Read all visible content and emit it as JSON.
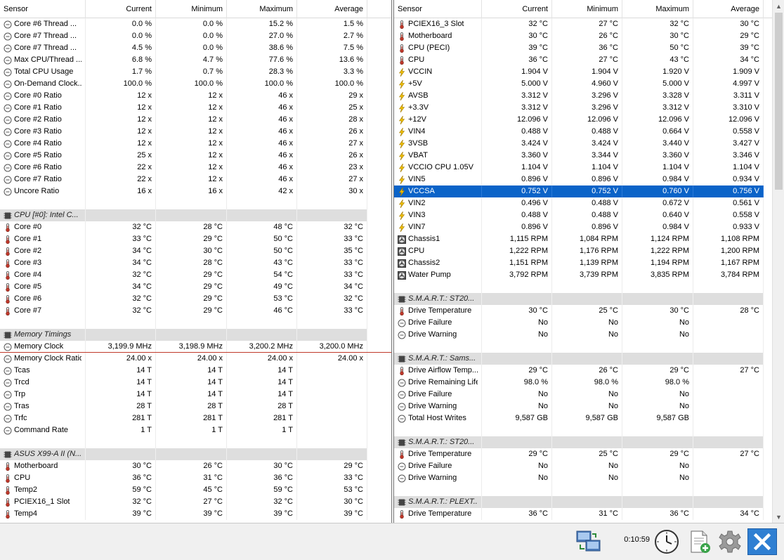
{
  "columns": {
    "sensor": "Sensor",
    "current": "Current",
    "minimum": "Minimum",
    "maximum": "Maximum",
    "average": "Average"
  },
  "left_rows": [
    {
      "type": "row",
      "icon": "clock",
      "name": "Core #6 Thread ...",
      "cur": "0.0 %",
      "min": "0.0 %",
      "max": "15.2 %",
      "avg": "1.5 %"
    },
    {
      "type": "row",
      "icon": "clock",
      "name": "Core #7 Thread ...",
      "cur": "0.0 %",
      "min": "0.0 %",
      "max": "27.0 %",
      "avg": "2.7 %"
    },
    {
      "type": "row",
      "icon": "clock",
      "name": "Core #7 Thread ...",
      "cur": "4.5 %",
      "min": "0.0 %",
      "max": "38.6 %",
      "avg": "7.5 %"
    },
    {
      "type": "row",
      "icon": "clock",
      "name": "Max CPU/Thread ...",
      "cur": "6.8 %",
      "min": "4.7 %",
      "max": "77.6 %",
      "avg": "13.6 %"
    },
    {
      "type": "row",
      "icon": "clock",
      "name": "Total CPU Usage",
      "cur": "1.7 %",
      "min": "0.7 %",
      "max": "28.3 %",
      "avg": "3.3 %"
    },
    {
      "type": "row",
      "icon": "clock",
      "name": "On-Demand Clock...",
      "cur": "100.0 %",
      "min": "100.0 %",
      "max": "100.0 %",
      "avg": "100.0 %"
    },
    {
      "type": "row",
      "icon": "clock",
      "name": "Core #0 Ratio",
      "cur": "12 x",
      "min": "12 x",
      "max": "46 x",
      "avg": "29 x"
    },
    {
      "type": "row",
      "icon": "clock",
      "name": "Core #1 Ratio",
      "cur": "12 x",
      "min": "12 x",
      "max": "46 x",
      "avg": "25 x"
    },
    {
      "type": "row",
      "icon": "clock",
      "name": "Core #2 Ratio",
      "cur": "12 x",
      "min": "12 x",
      "max": "46 x",
      "avg": "28 x"
    },
    {
      "type": "row",
      "icon": "clock",
      "name": "Core #3 Ratio",
      "cur": "12 x",
      "min": "12 x",
      "max": "46 x",
      "avg": "26 x"
    },
    {
      "type": "row",
      "icon": "clock",
      "name": "Core #4 Ratio",
      "cur": "12 x",
      "min": "12 x",
      "max": "46 x",
      "avg": "27 x"
    },
    {
      "type": "row",
      "icon": "clock",
      "name": "Core #5 Ratio",
      "cur": "25 x",
      "min": "12 x",
      "max": "46 x",
      "avg": "26 x"
    },
    {
      "type": "row",
      "icon": "clock",
      "name": "Core #6 Ratio",
      "cur": "22 x",
      "min": "12 x",
      "max": "46 x",
      "avg": "23 x"
    },
    {
      "type": "row",
      "icon": "clock",
      "name": "Core #7 Ratio",
      "cur": "22 x",
      "min": "12 x",
      "max": "46 x",
      "avg": "27 x"
    },
    {
      "type": "row",
      "icon": "clock",
      "name": "Uncore Ratio",
      "cur": "16 x",
      "min": "16 x",
      "max": "42 x",
      "avg": "30 x"
    },
    {
      "type": "blank"
    },
    {
      "type": "group",
      "icon": "chip",
      "name": "CPU [#0]: Intel C..."
    },
    {
      "type": "row",
      "icon": "thermo",
      "name": "Core #0",
      "cur": "32 °C",
      "min": "28 °C",
      "max": "48 °C",
      "avg": "32 °C"
    },
    {
      "type": "row",
      "icon": "thermo",
      "name": "Core #1",
      "cur": "33 °C",
      "min": "29 °C",
      "max": "50 °C",
      "avg": "33 °C"
    },
    {
      "type": "row",
      "icon": "thermo",
      "name": "Core #2",
      "cur": "34 °C",
      "min": "30 °C",
      "max": "50 °C",
      "avg": "35 °C"
    },
    {
      "type": "row",
      "icon": "thermo",
      "name": "Core #3",
      "cur": "34 °C",
      "min": "28 °C",
      "max": "43 °C",
      "avg": "33 °C"
    },
    {
      "type": "row",
      "icon": "thermo",
      "name": "Core #4",
      "cur": "32 °C",
      "min": "29 °C",
      "max": "54 °C",
      "avg": "33 °C"
    },
    {
      "type": "row",
      "icon": "thermo",
      "name": "Core #5",
      "cur": "34 °C",
      "min": "29 °C",
      "max": "49 °C",
      "avg": "34 °C"
    },
    {
      "type": "row",
      "icon": "thermo",
      "name": "Core #6",
      "cur": "32 °C",
      "min": "29 °C",
      "max": "53 °C",
      "avg": "32 °C"
    },
    {
      "type": "row",
      "icon": "thermo",
      "name": "Core #7",
      "cur": "32 °C",
      "min": "29 °C",
      "max": "46 °C",
      "avg": "33 °C"
    },
    {
      "type": "blank"
    },
    {
      "type": "group",
      "icon": "chip",
      "name": "Memory Timings"
    },
    {
      "type": "row",
      "icon": "clock",
      "name": "Memory Clock",
      "cur": "3,199.9 MHz",
      "min": "3,198.9 MHz",
      "max": "3,200.2 MHz",
      "avg": "3,200.0 MHz",
      "redline": true
    },
    {
      "type": "row",
      "icon": "clock",
      "name": "Memory Clock Ratio",
      "cur": "24.00 x",
      "min": "24.00 x",
      "max": "24.00 x",
      "avg": "24.00 x"
    },
    {
      "type": "row",
      "icon": "clock",
      "name": "Tcas",
      "cur": "14 T",
      "min": "14 T",
      "max": "14 T",
      "avg": ""
    },
    {
      "type": "row",
      "icon": "clock",
      "name": "Trcd",
      "cur": "14 T",
      "min": "14 T",
      "max": "14 T",
      "avg": ""
    },
    {
      "type": "row",
      "icon": "clock",
      "name": "Trp",
      "cur": "14 T",
      "min": "14 T",
      "max": "14 T",
      "avg": ""
    },
    {
      "type": "row",
      "icon": "clock",
      "name": "Tras",
      "cur": "28 T",
      "min": "28 T",
      "max": "28 T",
      "avg": ""
    },
    {
      "type": "row",
      "icon": "clock",
      "name": "Trfc",
      "cur": "281 T",
      "min": "281 T",
      "max": "281 T",
      "avg": ""
    },
    {
      "type": "row",
      "icon": "clock",
      "name": "Command Rate",
      "cur": "1 T",
      "min": "1 T",
      "max": "1 T",
      "avg": ""
    },
    {
      "type": "blank"
    },
    {
      "type": "group",
      "icon": "chip",
      "name": "ASUS X99-A II (N..."
    },
    {
      "type": "row",
      "icon": "thermo",
      "name": "Motherboard",
      "cur": "30 °C",
      "min": "26 °C",
      "max": "30 °C",
      "avg": "29 °C"
    },
    {
      "type": "row",
      "icon": "thermo",
      "name": "CPU",
      "cur": "36 °C",
      "min": "31 °C",
      "max": "36 °C",
      "avg": "33 °C"
    },
    {
      "type": "row",
      "icon": "thermo",
      "name": "Temp2",
      "cur": "59 °C",
      "min": "45 °C",
      "max": "59 °C",
      "avg": "53 °C"
    },
    {
      "type": "row",
      "icon": "thermo",
      "name": "PCIEX16_1 Slot",
      "cur": "32 °C",
      "min": "27 °C",
      "max": "32 °C",
      "avg": "30 °C"
    },
    {
      "type": "row",
      "icon": "thermo",
      "name": "Temp4",
      "cur": "39 °C",
      "min": "39 °C",
      "max": "39 °C",
      "avg": "39 °C"
    }
  ],
  "right_rows": [
    {
      "type": "row",
      "icon": "thermo",
      "name": "PCIEX16_3 Slot",
      "cur": "32 °C",
      "min": "27 °C",
      "max": "32 °C",
      "avg": "30 °C"
    },
    {
      "type": "row",
      "icon": "thermo",
      "name": "Motherboard",
      "cur": "30 °C",
      "min": "26 °C",
      "max": "30 °C",
      "avg": "29 °C"
    },
    {
      "type": "row",
      "icon": "thermo",
      "name": "CPU (PECI)",
      "cur": "39 °C",
      "min": "36 °C",
      "max": "50 °C",
      "avg": "39 °C"
    },
    {
      "type": "row",
      "icon": "thermo",
      "name": "CPU",
      "cur": "36 °C",
      "min": "27 °C",
      "max": "43 °C",
      "avg": "34 °C"
    },
    {
      "type": "row",
      "icon": "bolt",
      "name": "VCCIN",
      "cur": "1.904 V",
      "min": "1.904 V",
      "max": "1.920 V",
      "avg": "1.909 V"
    },
    {
      "type": "row",
      "icon": "bolt",
      "name": "+5V",
      "cur": "5.000 V",
      "min": "4.960 V",
      "max": "5.000 V",
      "avg": "4.997 V"
    },
    {
      "type": "row",
      "icon": "bolt",
      "name": "AVSB",
      "cur": "3.312 V",
      "min": "3.296 V",
      "max": "3.328 V",
      "avg": "3.311 V"
    },
    {
      "type": "row",
      "icon": "bolt",
      "name": "+3.3V",
      "cur": "3.312 V",
      "min": "3.296 V",
      "max": "3.312 V",
      "avg": "3.310 V"
    },
    {
      "type": "row",
      "icon": "bolt",
      "name": "+12V",
      "cur": "12.096 V",
      "min": "12.096 V",
      "max": "12.096 V",
      "avg": "12.096 V"
    },
    {
      "type": "row",
      "icon": "bolt",
      "name": "VIN4",
      "cur": "0.488 V",
      "min": "0.488 V",
      "max": "0.664 V",
      "avg": "0.558 V"
    },
    {
      "type": "row",
      "icon": "bolt",
      "name": "3VSB",
      "cur": "3.424 V",
      "min": "3.424 V",
      "max": "3.440 V",
      "avg": "3.427 V"
    },
    {
      "type": "row",
      "icon": "bolt",
      "name": "VBAT",
      "cur": "3.360 V",
      "min": "3.344 V",
      "max": "3.360 V",
      "avg": "3.346 V"
    },
    {
      "type": "row",
      "icon": "bolt",
      "name": "VCCIO CPU 1.05V",
      "cur": "1.104 V",
      "min": "1.104 V",
      "max": "1.104 V",
      "avg": "1.104 V"
    },
    {
      "type": "row",
      "icon": "bolt",
      "name": "VIN5",
      "cur": "0.896 V",
      "min": "0.896 V",
      "max": "0.984 V",
      "avg": "0.934 V"
    },
    {
      "type": "row",
      "icon": "bolt",
      "name": "VCCSA",
      "cur": "0.752 V",
      "min": "0.752 V",
      "max": "0.760 V",
      "avg": "0.756 V",
      "selected": true
    },
    {
      "type": "row",
      "icon": "bolt",
      "name": "VIN2",
      "cur": "0.496 V",
      "min": "0.488 V",
      "max": "0.672 V",
      "avg": "0.561 V"
    },
    {
      "type": "row",
      "icon": "bolt",
      "name": "VIN3",
      "cur": "0.488 V",
      "min": "0.488 V",
      "max": "0.640 V",
      "avg": "0.558 V"
    },
    {
      "type": "row",
      "icon": "bolt",
      "name": "VIN7",
      "cur": "0.896 V",
      "min": "0.896 V",
      "max": "0.984 V",
      "avg": "0.933 V"
    },
    {
      "type": "row",
      "icon": "fan",
      "name": "Chassis1",
      "cur": "1,115 RPM",
      "min": "1,084 RPM",
      "max": "1,124 RPM",
      "avg": "1,108 RPM"
    },
    {
      "type": "row",
      "icon": "fan",
      "name": "CPU",
      "cur": "1,222 RPM",
      "min": "1,176 RPM",
      "max": "1,222 RPM",
      "avg": "1,200 RPM"
    },
    {
      "type": "row",
      "icon": "fan",
      "name": "Chassis2",
      "cur": "1,151 RPM",
      "min": "1,139 RPM",
      "max": "1,194 RPM",
      "avg": "1,167 RPM"
    },
    {
      "type": "row",
      "icon": "fan",
      "name": "Water Pump",
      "cur": "3,792 RPM",
      "min": "3,739 RPM",
      "max": "3,835 RPM",
      "avg": "3,784 RPM"
    },
    {
      "type": "blank"
    },
    {
      "type": "group",
      "icon": "chip",
      "name": "S.M.A.R.T.: ST20..."
    },
    {
      "type": "row",
      "icon": "thermo",
      "name": "Drive Temperature",
      "cur": "30 °C",
      "min": "25 °C",
      "max": "30 °C",
      "avg": "28 °C"
    },
    {
      "type": "row",
      "icon": "clock",
      "name": "Drive Failure",
      "cur": "No",
      "min": "No",
      "max": "No",
      "avg": ""
    },
    {
      "type": "row",
      "icon": "clock",
      "name": "Drive Warning",
      "cur": "No",
      "min": "No",
      "max": "No",
      "avg": ""
    },
    {
      "type": "blank"
    },
    {
      "type": "group",
      "icon": "chip",
      "name": "S.M.A.R.T.: Sams..."
    },
    {
      "type": "row",
      "icon": "thermo",
      "name": "Drive Airflow Temp...",
      "cur": "29 °C",
      "min": "26 °C",
      "max": "29 °C",
      "avg": "27 °C"
    },
    {
      "type": "row",
      "icon": "clock",
      "name": "Drive Remaining Life",
      "cur": "98.0 %",
      "min": "98.0 %",
      "max": "98.0 %",
      "avg": ""
    },
    {
      "type": "row",
      "icon": "clock",
      "name": "Drive Failure",
      "cur": "No",
      "min": "No",
      "max": "No",
      "avg": ""
    },
    {
      "type": "row",
      "icon": "clock",
      "name": "Drive Warning",
      "cur": "No",
      "min": "No",
      "max": "No",
      "avg": ""
    },
    {
      "type": "row",
      "icon": "clock",
      "name": "Total Host Writes",
      "cur": "9,587 GB",
      "min": "9,587 GB",
      "max": "9,587 GB",
      "avg": ""
    },
    {
      "type": "blank"
    },
    {
      "type": "group",
      "icon": "chip",
      "name": "S.M.A.R.T.: ST20..."
    },
    {
      "type": "row",
      "icon": "thermo",
      "name": "Drive Temperature",
      "cur": "29 °C",
      "min": "25 °C",
      "max": "29 °C",
      "avg": "27 °C"
    },
    {
      "type": "row",
      "icon": "clock",
      "name": "Drive Failure",
      "cur": "No",
      "min": "No",
      "max": "No",
      "avg": ""
    },
    {
      "type": "row",
      "icon": "clock",
      "name": "Drive Warning",
      "cur": "No",
      "min": "No",
      "max": "No",
      "avg": ""
    },
    {
      "type": "blank"
    },
    {
      "type": "group",
      "icon": "chip",
      "name": "S.M.A.R.T.: PLEXT..."
    },
    {
      "type": "row",
      "icon": "thermo",
      "name": "Drive Temperature",
      "cur": "36 °C",
      "min": "31 °C",
      "max": "36 °C",
      "avg": "34 °C"
    }
  ],
  "toolbar": {
    "timer": "0:10:59",
    "buttons": [
      {
        "name": "network-button",
        "icon": "network-icon"
      },
      {
        "name": "clock-button",
        "icon": "clock-icon"
      },
      {
        "name": "add-report-button",
        "icon": "document-add-icon"
      },
      {
        "name": "settings-button",
        "icon": "gear-icon"
      },
      {
        "name": "close-button",
        "icon": "close-icon"
      }
    ]
  },
  "colors": {
    "selection": "#0a63c8",
    "group_bg": "#dedede",
    "bolt": "#e8b400",
    "close_bg": "#2f7fd2"
  }
}
